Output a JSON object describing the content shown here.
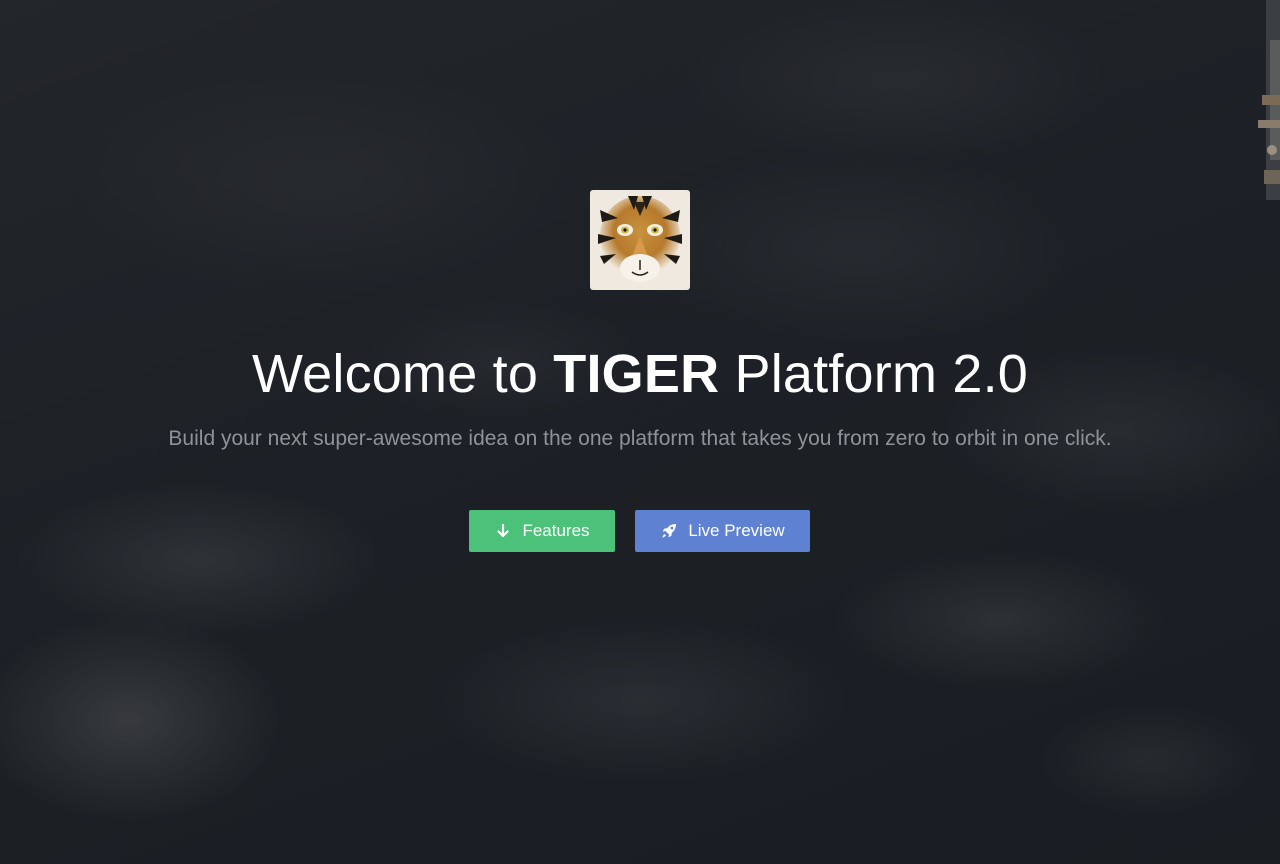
{
  "hero": {
    "title_prefix": "Welcome to ",
    "title_brand": "TIGER",
    "title_suffix": " Platform 2.0",
    "subtitle": "Build your next super-awesome idea on the one platform that takes you from zero to orbit in one click."
  },
  "buttons": {
    "features_label": "Features",
    "features_icon": "arrow-down-icon",
    "preview_label": "Live Preview",
    "preview_icon": "rocket-icon"
  },
  "colors": {
    "features_button": "#4cc17a",
    "preview_button": "#5f81d1",
    "subtitle_text": "#8e939a",
    "title_text": "#ffffff"
  }
}
